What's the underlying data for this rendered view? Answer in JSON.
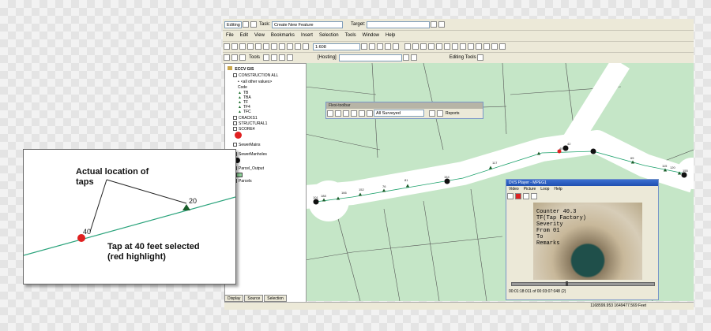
{
  "toolbar": {
    "editor_label": "Editing",
    "task_label": "Task:",
    "task_value": "Create New Feature",
    "target_label": "Target:",
    "target_value": "",
    "scale_value": "1:608",
    "tools_label": "Tools",
    "hosting_label": "[Hosting]",
    "editing_tools_label": "Editing Tools"
  },
  "menu": [
    "File",
    "Edit",
    "View",
    "Bookmarks",
    "Insert",
    "Selection",
    "Tools",
    "Window",
    "Help"
  ],
  "toc": {
    "root": "ECCV GIS",
    "items": [
      {
        "label": "CONSTRUCTION ALL",
        "type": "checkbox"
      },
      {
        "label": "<all other values>",
        "type": "symbol"
      },
      {
        "label": "Code",
        "type": "text"
      },
      {
        "label": "TB",
        "type": "tri"
      },
      {
        "label": "TBA",
        "type": "tri"
      },
      {
        "label": "TF",
        "type": "tri"
      },
      {
        "label": "TF4",
        "type": "tri"
      },
      {
        "label": "TFC",
        "type": "tri"
      },
      {
        "label": "CRACKS1",
        "type": "checkbox"
      },
      {
        "label": "STRUCTURAL1",
        "type": "checkbox"
      },
      {
        "label": "SCORE4",
        "type": "checkbox"
      },
      {
        "label": "SewerMains",
        "type": "checkbox"
      },
      {
        "label": "SewerManholes",
        "type": "checkbox"
      },
      {
        "label": "Parcel_Output",
        "type": "checkbox"
      },
      {
        "label": "Parcels",
        "type": "checkbox"
      }
    ],
    "tabs": [
      "Display",
      "Source",
      "Selection"
    ]
  },
  "float_toolbar": {
    "title": "Flexi-toolbar",
    "combo_value": "All Surveyed",
    "reports_label": "Reports"
  },
  "player": {
    "title": "DVS Player - MPEG1",
    "menu": [
      "Video",
      "Picture",
      "Loop",
      "Help"
    ],
    "overlay": [
      "Counter 40.3",
      "TF(Tap Factory)",
      "Severity",
      "From 01",
      "To",
      "Remarks"
    ],
    "time": "00:01:18:011 of 00:03:07:048 (2)"
  },
  "status": {
    "coords": "1168599.953  1649477.569 Feet"
  },
  "map": {
    "labels": [
      "40",
      "42",
      "65",
      "115",
      "120",
      "155",
      "117",
      "81",
      "76",
      "152",
      "166",
      "188",
      "101",
      "154"
    ]
  },
  "callout": {
    "annotation1": "Actual location of taps",
    "tap_a": "40",
    "tap_b": "20",
    "annotation2": "Tap at 40 feet selected (red highlight)"
  }
}
